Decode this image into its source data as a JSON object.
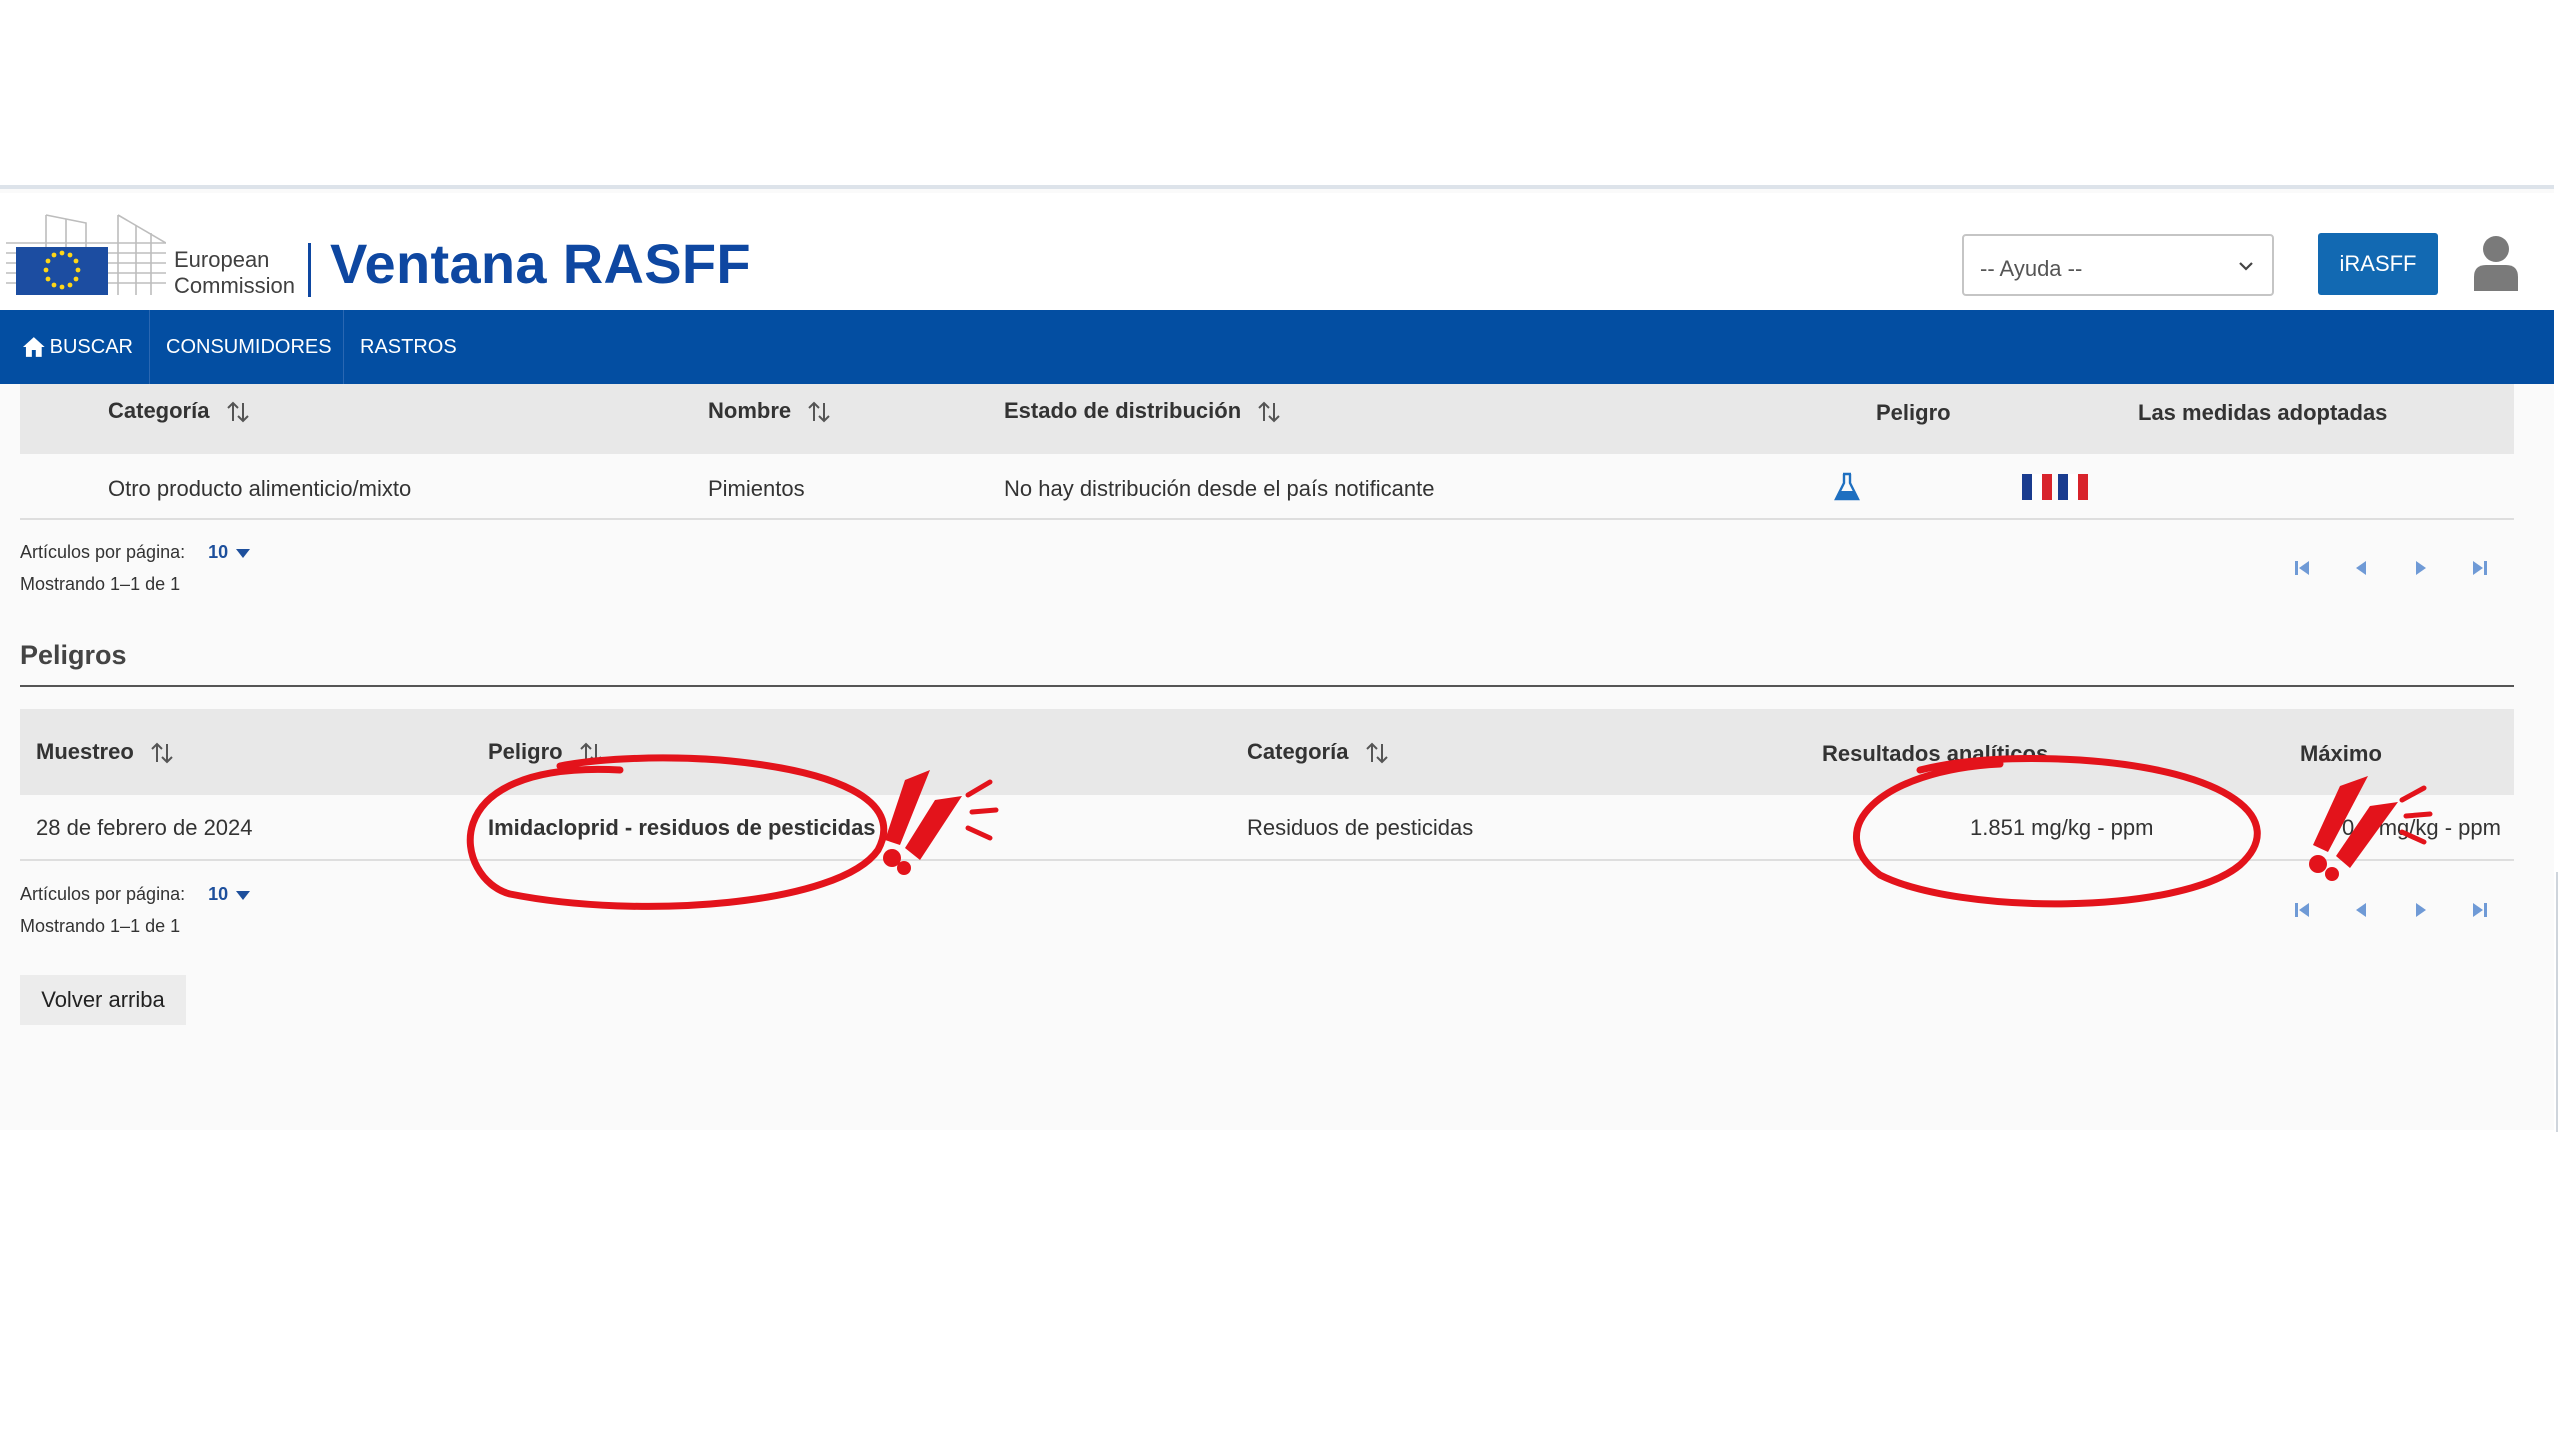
{
  "header": {
    "logo_line1": "European",
    "logo_line2": "Commission",
    "app_title": "Ventana RASFF",
    "help_select_value": "-- Ayuda --",
    "irasff_label": "iRASFF"
  },
  "nav": {
    "items": [
      {
        "label": "BUSCAR",
        "icon": "home-icon"
      },
      {
        "label": "CONSUMIDORES"
      },
      {
        "label": "RASTROS",
        "icon": "caret-down-icon"
      }
    ]
  },
  "distribution": {
    "headers": [
      "Categoría",
      "Nombre",
      "Estado de distribución",
      "Peligro",
      "Las medidas adoptadas"
    ],
    "rows": [
      {
        "categoria": "Otro producto alimenticio/mixto",
        "nombre": "Pimientos",
        "estado": "No hay distribución desde el país notificante",
        "peligro_icon": "flask-icon",
        "medidas_icon": "france-flag-icon"
      }
    ],
    "pager": {
      "per_page_label": "Artículos por página:",
      "per_page_value": "10",
      "showing": "Mostrando 1–1 de 1"
    }
  },
  "peligros": {
    "title": "Peligros",
    "headers": [
      "Muestreo",
      "Peligro",
      "Categoría",
      "Resultados analíticos",
      "Máximo"
    ],
    "rows": [
      {
        "muestreo": "28 de febrero de 2024",
        "peligro": "Imidacloprid - residuos de pesticidas",
        "categoria": "Residuos de pesticidas",
        "resultado": "1.851 mg/kg - ppm",
        "maximo": "0,9 mg/kg - ppm"
      }
    ],
    "pager": {
      "per_page_label": "Artículos por página:",
      "per_page_value": "10",
      "showing": "Mostrando 1–1 de 1"
    }
  },
  "back_to_top": "Volver arriba",
  "colors": {
    "brand_blue": "#034ea2",
    "title_blue": "#0e47a1",
    "button_blue": "#1269b2",
    "annotation_red": "#e3131b"
  }
}
